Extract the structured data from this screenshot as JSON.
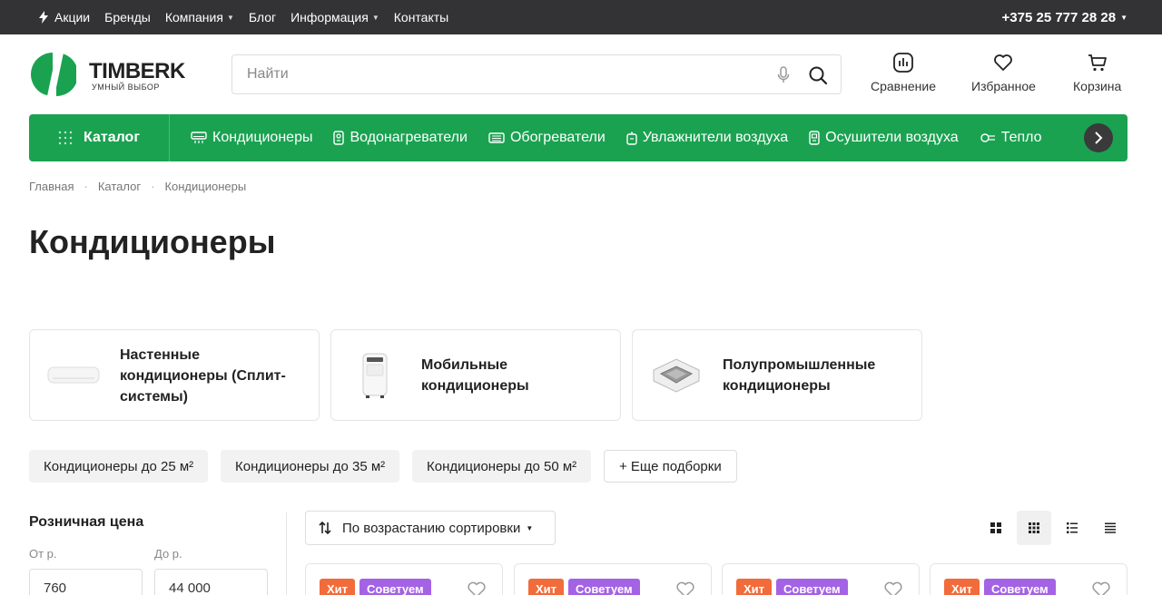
{
  "topbar": {
    "nav": [
      {
        "label": "Акции",
        "dropdown": false,
        "icon": "bolt-icon"
      },
      {
        "label": "Бренды",
        "dropdown": false
      },
      {
        "label": "Компания",
        "dropdown": true
      },
      {
        "label": "Блог",
        "dropdown": false
      },
      {
        "label": "Информация",
        "dropdown": true
      },
      {
        "label": "Контакты",
        "dropdown": false
      }
    ],
    "phone": "+375 25 777 28 28"
  },
  "logo": {
    "brand": "TIMBERK",
    "tagline": "УМНЫЙ ВЫБОР"
  },
  "search": {
    "placeholder": "Найти",
    "value": ""
  },
  "header_actions": {
    "compare": "Сравнение",
    "favorites": "Избранное",
    "cart": "Корзина"
  },
  "catbar": {
    "catalog_label": "Каталог",
    "categories": [
      "Кондиционеры",
      "Водонагреватели",
      "Обогреватели",
      "Увлажнители воздуха",
      "Осушители воздуха",
      "Тепло"
    ]
  },
  "breadcrumb": [
    "Главная",
    "Каталог",
    "Кондиционеры"
  ],
  "page_title": "Кондиционеры",
  "subcategories": [
    "Настенные кондиционеры (Сплит-системы)",
    "Мобильные кондиционеры",
    "Полупромышленные кондиционеры"
  ],
  "chips": [
    "Кондиционеры до 25 м²",
    "Кондиционеры до 35 м²",
    "Кондиционеры до 50 м²",
    "+ Еще подборки"
  ],
  "filter": {
    "title": "Розничная цена",
    "from_label": "От р.",
    "to_label": "До р.",
    "from_value": "760",
    "to_value": "44 000"
  },
  "sort": {
    "label": "По возрастанию сортировки"
  },
  "view_modes": {
    "active": "grid-small"
  },
  "product_badges": {
    "hit": "Хит",
    "recommend": "Советуем"
  },
  "colors": {
    "green": "#1aa251",
    "topbar": "#333336",
    "hit": "#f26b3a",
    "recommend": "#a463e4"
  }
}
